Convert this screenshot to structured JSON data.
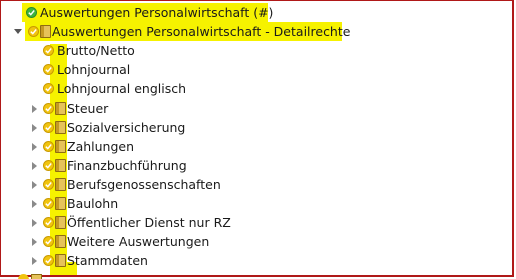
{
  "tree": {
    "root": {
      "label": "Auswertungen Personalwirtschaft (#)"
    },
    "group": {
      "label": "Auswertungen Personalwirtschaft - Detailrechte"
    },
    "leaves": [
      {
        "label": "Brutto/Netto"
      },
      {
        "label": "Lohnjournal"
      },
      {
        "label": "Lohnjournal englisch"
      }
    ],
    "folders": [
      {
        "label": "Steuer"
      },
      {
        "label": "Sozialversicherung"
      },
      {
        "label": "Zahlungen"
      },
      {
        "label": "Finanzbuchführung"
      },
      {
        "label": "Berufsgenossenschaften"
      },
      {
        "label": "Baulohn"
      },
      {
        "label": "Öffentlicher Dienst nur RZ"
      },
      {
        "label": "Weitere Auswertungen"
      },
      {
        "label": "Stammdaten"
      }
    ]
  },
  "colors": {
    "highlight": "#f6f200",
    "check_green": "#3fb33f",
    "check_yellow": "#f1c40f",
    "frame": "#b01818"
  },
  "icons": {
    "root": "green-check-icon",
    "item": "yellow-check-icon",
    "folder": "book-icon",
    "expander": "triangle-expander-icon"
  }
}
